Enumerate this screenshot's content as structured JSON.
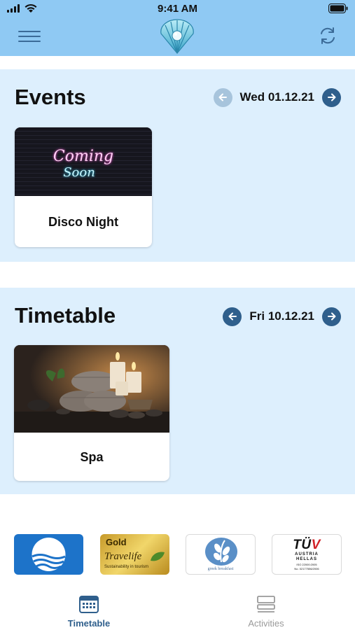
{
  "status_bar": {
    "time": "9:41 AM"
  },
  "header": {
    "menu_icon": "hamburger-icon",
    "logo_icon": "seashell-logo",
    "refresh_icon": "refresh-icon"
  },
  "events": {
    "title": "Events",
    "date": "Wed 01.12.21",
    "prev_enabled": false,
    "cards": [
      {
        "label": "Disco Night",
        "image_text_1": "Coming",
        "image_text_2": "Soon"
      }
    ]
  },
  "timetable": {
    "title": "Timetable",
    "date": "Fri 10.12.21",
    "prev_enabled": true,
    "cards": [
      {
        "label": "Spa"
      }
    ]
  },
  "badges": {
    "travelife": {
      "tier": "Gold",
      "name": "Travelife",
      "tagline": "Sustainability in tourism"
    },
    "greek_breakfast": {
      "caption": "greek breakfast"
    },
    "tuv": {
      "brand": "TÜV",
      "line1": "AUSTRIA",
      "line2": "HELLAS",
      "line3": "ISO 22000:2005",
      "line4": "No. 02177556/2006"
    }
  },
  "tabbar": {
    "tabs": [
      {
        "label": "Timetable",
        "active": true
      },
      {
        "label": "Activities",
        "active": false
      }
    ]
  },
  "colors": {
    "header_bg": "#8fc9f3",
    "section_bg": "#ddeffd",
    "accent": "#2f5f8c",
    "inactive": "#9a9a9a"
  }
}
